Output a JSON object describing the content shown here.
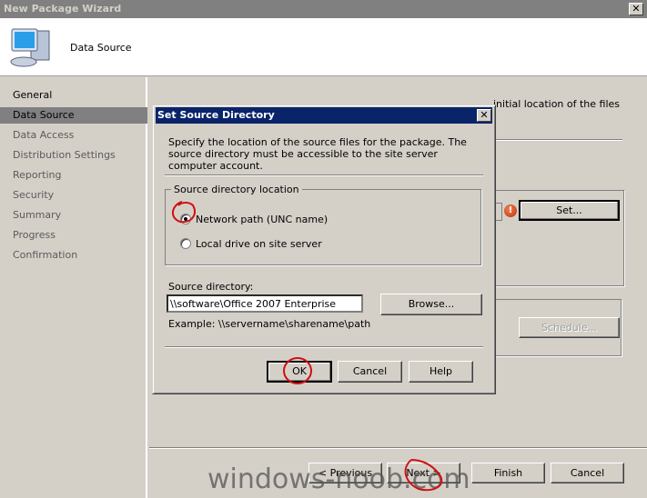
{
  "window": {
    "title": "New Package Wizard",
    "close_glyph": "✕"
  },
  "header": {
    "title": "Data Source",
    "icon": "computer-icon"
  },
  "sidebar": {
    "items": [
      {
        "label": "General",
        "state": "done"
      },
      {
        "label": "Data Source",
        "state": "active"
      },
      {
        "label": "Data Access",
        "state": "pending"
      },
      {
        "label": "Distribution Settings",
        "state": "pending"
      },
      {
        "label": "Reporting",
        "state": "pending"
      },
      {
        "label": "Security",
        "state": "pending"
      },
      {
        "label": "Summary",
        "state": "pending"
      },
      {
        "label": "Progress",
        "state": "pending"
      },
      {
        "label": "Confirmation",
        "state": "pending"
      }
    ]
  },
  "main": {
    "intro_fragment": "initial location of the files",
    "set_button": "Set...",
    "schedule_button": "Schedule...",
    "warning_icon": "error-icon"
  },
  "footer": {
    "previous": "< Previous",
    "next": "Next >",
    "finish": "Finish",
    "cancel": "Cancel"
  },
  "dialog": {
    "title": "Set Source Directory",
    "close_glyph": "✕",
    "description": "Specify the location of the source files for the package. The source directory must be accessible to the site server computer account.",
    "group_label": "Source directory location",
    "options": [
      {
        "label": "Network path (UNC name)",
        "selected": true
      },
      {
        "label": "Local drive on site server",
        "selected": false
      }
    ],
    "source_label": "Source directory:",
    "source_value": "\\\\software\\Office 2007 Enterprise",
    "browse": "Browse...",
    "example": "Example: \\\\servername\\sharename\\path",
    "ok": "OK",
    "cancel": "Cancel",
    "help": "Help"
  },
  "watermark": "windows-noob.com",
  "annotation_color": "#d01010"
}
